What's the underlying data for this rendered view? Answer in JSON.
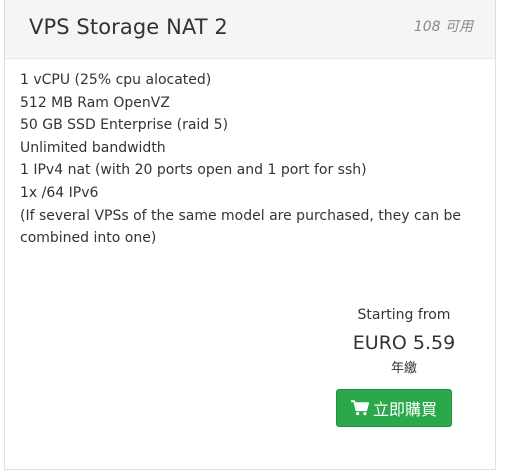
{
  "product": {
    "name": "VPS Storage NAT 2",
    "quantity_available": "108 可用",
    "features": [
      "1 vCPU (25% cpu alocated)",
      "512 MB Ram OpenVZ",
      "50 GB SSD Enterprise (raid 5)",
      "Unlimited bandwidth",
      "1 IPv4 nat (with 20 ports open and 1 port for ssh)",
      "1x /64 IPv6",
      "(If several VPSs of the same model are purchased, they can be combined into one)"
    ],
    "pricing": {
      "starting_from": "Starting from",
      "price": "EURO 5.59",
      "cycle": "年繳"
    },
    "order_button": {
      "label": "立即購買",
      "icon": "shopping-cart-icon",
      "color": "#2aa84a"
    }
  }
}
